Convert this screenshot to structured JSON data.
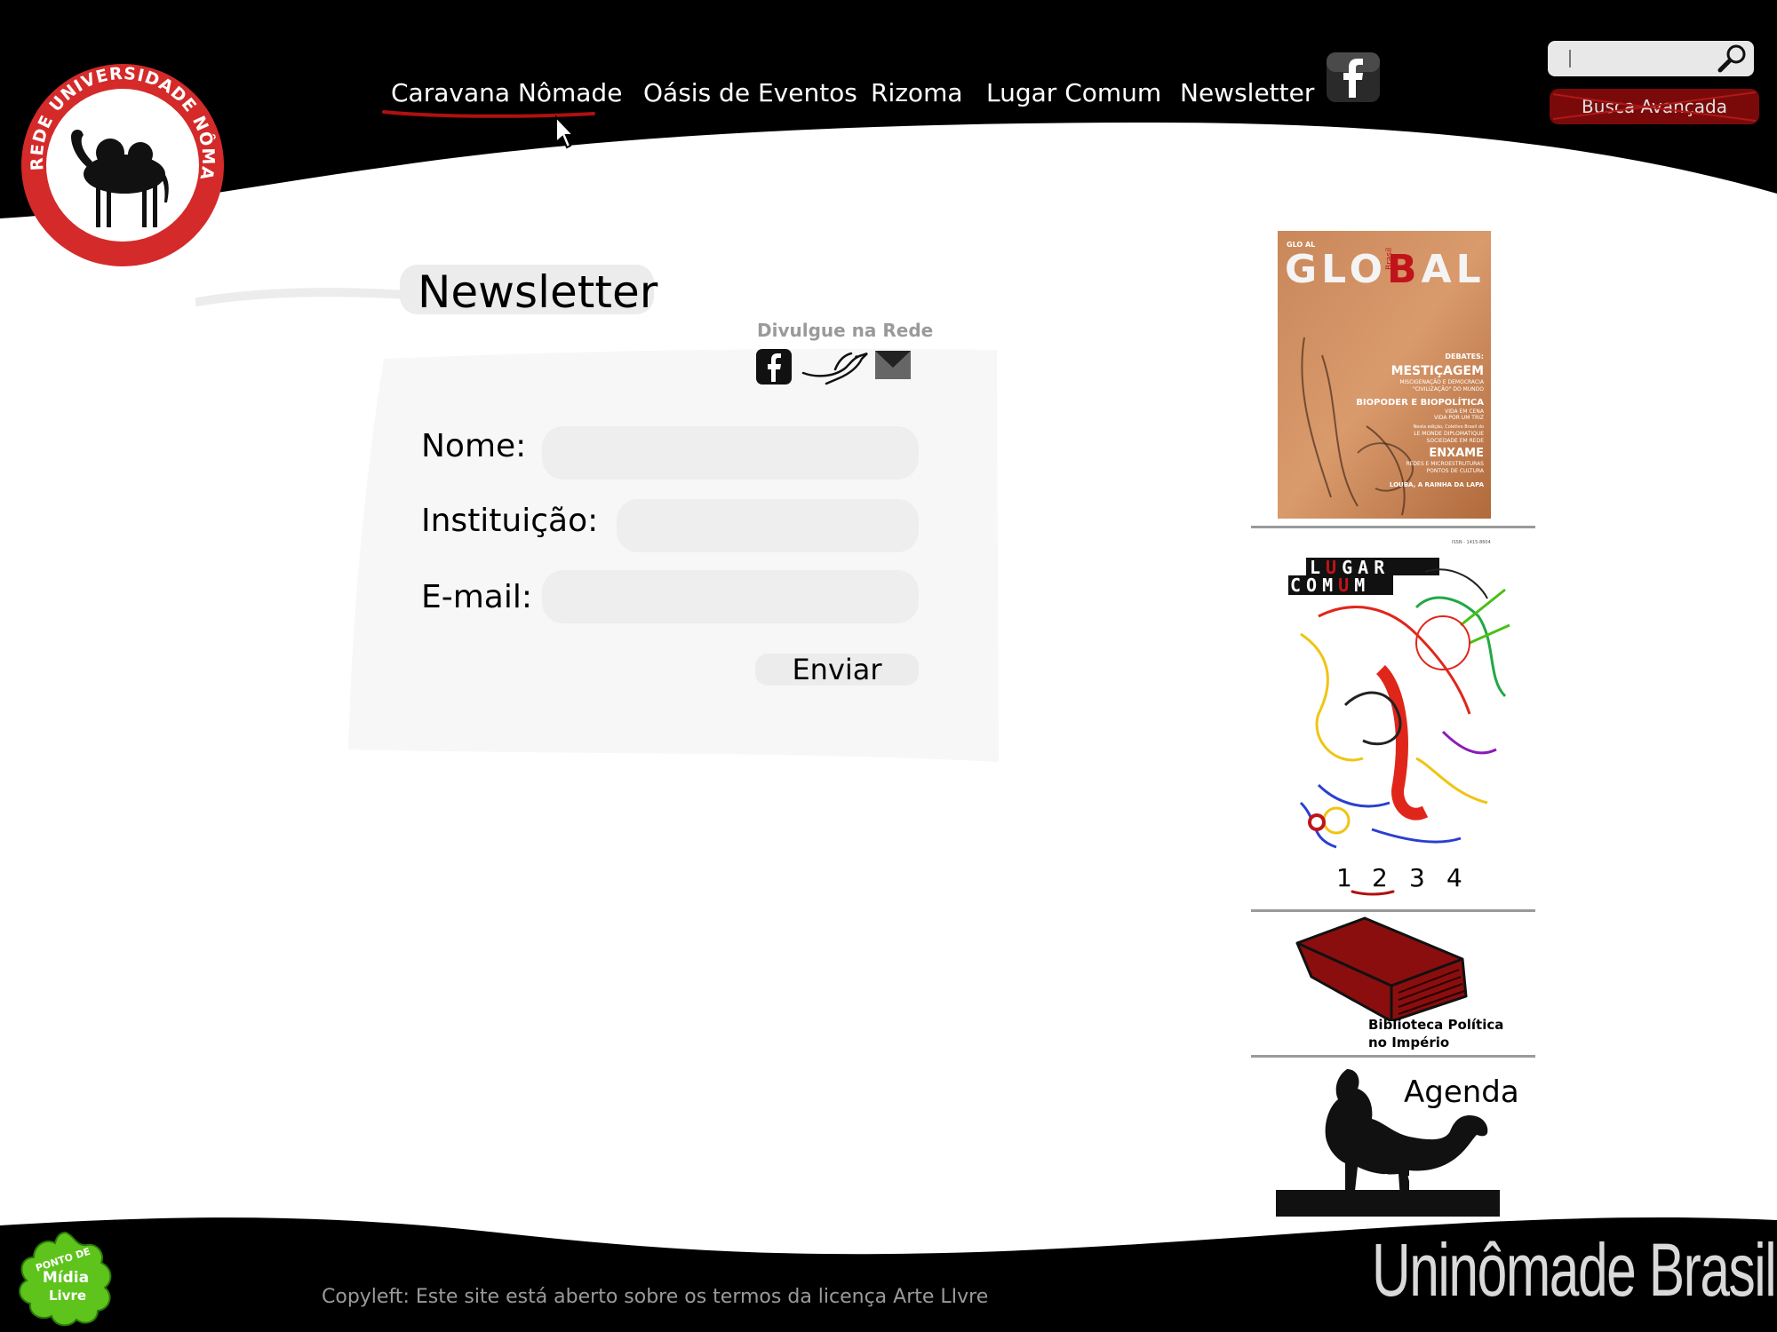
{
  "logo": {
    "ring_text": "REDE UNIVERSIDADE NÔMADE",
    "icon": "camel-icon"
  },
  "nav": {
    "items": [
      {
        "label": "Caravana Nômade",
        "active": true
      },
      {
        "label": "Oásis de Eventos"
      },
      {
        "label": "Rizoma"
      },
      {
        "label": "Lugar Comum"
      },
      {
        "label": "Newsletter"
      }
    ],
    "facebook_icon": "facebook-icon"
  },
  "search": {
    "value": "",
    "icon": "search-icon",
    "advanced_label": "Busca Avançada"
  },
  "main": {
    "title": "Newsletter",
    "share": {
      "label": "Divulgue na Rede",
      "icons": [
        "facebook-icon",
        "bird-icon",
        "mail-icon"
      ]
    },
    "form": {
      "name_label": "Nome:",
      "name_value": "",
      "institution_label": "Instituição:",
      "institution_value": "",
      "email_label": "E-mail:",
      "email_value": "",
      "submit_label": "Enviar"
    }
  },
  "sidebar": {
    "magazine_global": {
      "title_parts": [
        "GLO",
        "B",
        "AL"
      ],
      "small_top": "GLO AL",
      "brazil_vertical": "Brasil",
      "headlines": [
        "DEBATES:",
        "MESTIÇAGEM",
        "MISCIGENAÇÃO E DEMOCRACIA",
        "\"CIVILIZAÇÃO\" DO MUNDO",
        "BIOPODER E BIOPOLÍTICA",
        "VIDA EM CENA",
        "VIDA POR UM TRIZ",
        "Nesta edição, Coletivo Brasil do",
        "LE MONDE DIPLOMATIQUE",
        "SOCIEDADE EM REDE",
        "ENXAME",
        "REDES E MICROESTRUTURAS",
        "PONTOS DE CULTURA",
        "LOUBA, A RAINHA DA LAPA"
      ]
    },
    "magazine_lugar_comum": {
      "line1": [
        "L",
        "U",
        "G",
        "A",
        "R"
      ],
      "line2": [
        "C",
        "O",
        "M",
        "U",
        "M"
      ],
      "top_caption": "ISSN - 1415-8604"
    },
    "pager": {
      "pages": [
        "1",
        "2",
        "3",
        "4"
      ],
      "current": "2"
    },
    "library": {
      "icon": "book-icon",
      "label_line1": "Biblioteca Política",
      "label_line2": "no Império"
    },
    "agenda": {
      "icon": "camel-rider-icon",
      "label": "Agenda"
    }
  },
  "footer": {
    "logo_lines": [
      "PONTO DE",
      "Mídia",
      "Livre"
    ],
    "copyleft": "Copyleft: Este site está aberto sobre os termos da licença Arte LIvre",
    "brand": "Uninômade Brasil"
  },
  "colors": {
    "header_bg": "#000000",
    "accent_red": "#8b0000",
    "input_bg": "#eeeeee",
    "muted_text": "#9a9a9a"
  }
}
